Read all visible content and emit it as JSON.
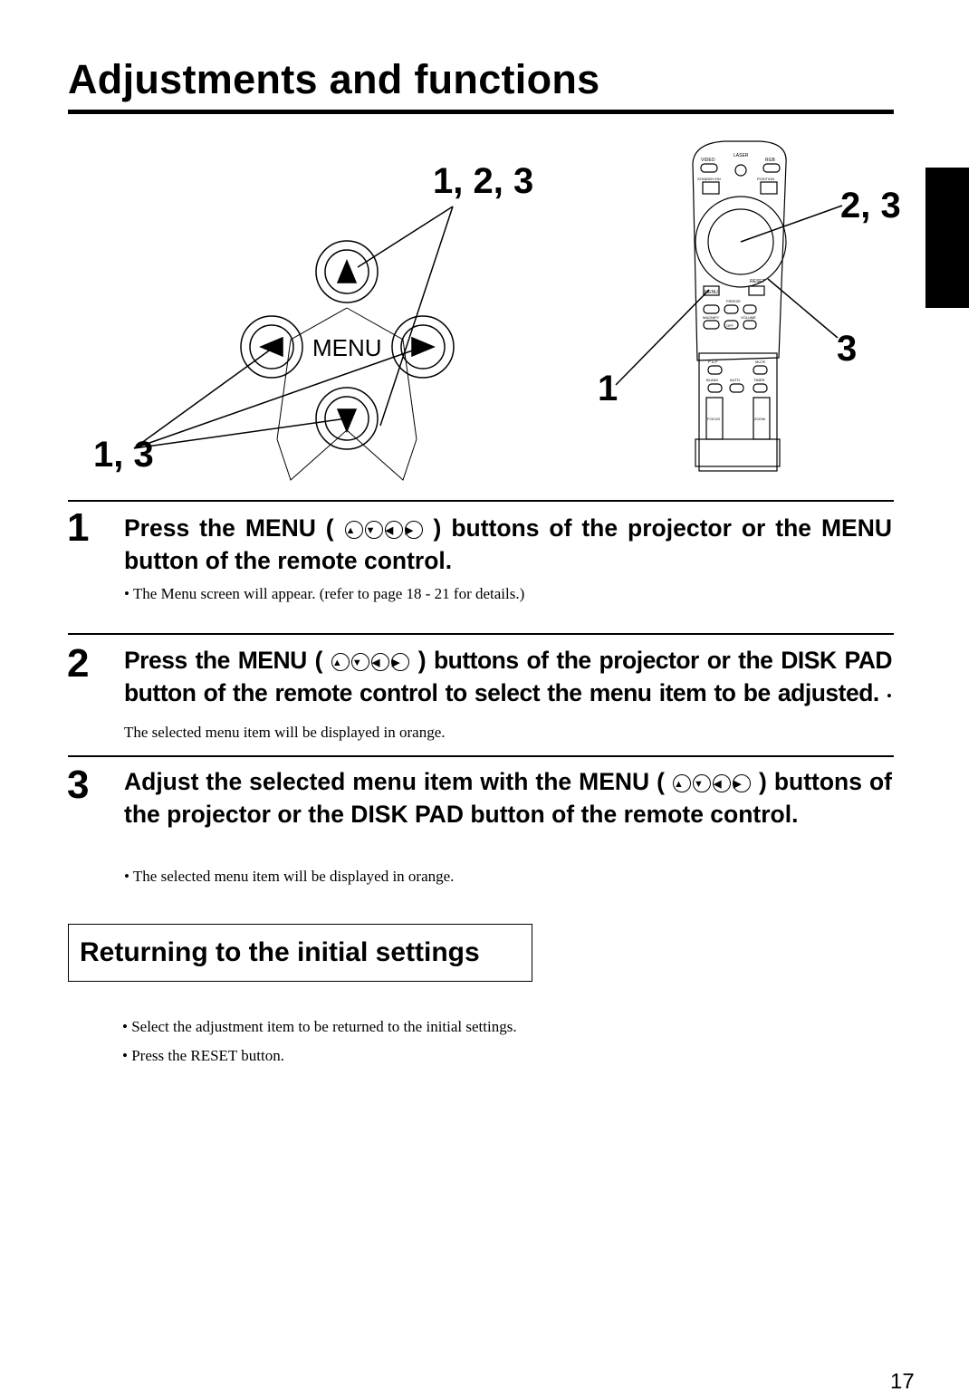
{
  "title": "Adjustments and functions",
  "illustration": {
    "panel_callout_top": "1, 2, 3",
    "panel_callout_bottom": "1, 3",
    "panel_menu_label": "MENU",
    "remote_callout_disk": "2, 3",
    "remote_callout_reset": "3",
    "remote_callout_menu": "1",
    "remote_labels": {
      "video": "VIDEO",
      "laser": "LASER",
      "rgb": "RGB",
      "standby": "STANDBY/ON",
      "position": "POSITION",
      "reset": "RESET",
      "menu": "MENU",
      "freeze": "FREEZE",
      "magnify": "MAGNIFY",
      "volume": "VOLUME",
      "off": "OFF",
      "pinp": "P in P",
      "mute": "MUTE",
      "blank": "BLANK",
      "auto": "AUTO",
      "timer": "TIMER",
      "focus": "FOCUS",
      "zoom": "ZOOM"
    }
  },
  "icons": {
    "up": "▲",
    "down": "▼",
    "left": "◀",
    "right": "▶"
  },
  "steps": [
    {
      "number": "1",
      "heading_a": "Press the MENU (",
      "heading_b": ") buttons of the projector or the MENU button of the remote control.",
      "note": "• The Menu screen will appear. (refer to page 18 - 21 for details.)"
    },
    {
      "number": "2",
      "heading_a": "Press the MENU (",
      "heading_b": ") buttons of the projector or the DISK PAD button of the remote control to select the menu item to be adjusted.",
      "note": "• The selected menu item will be displayed in orange."
    },
    {
      "number": "3",
      "heading_a": "Adjust the selected menu item with the MENU (",
      "heading_b": ") buttons of the projector or the DISK PAD button of the remote control.",
      "note": "• The selected menu item will be displayed in orange."
    }
  ],
  "reset_section": {
    "heading": "Returning to the initial settings",
    "bullets": [
      "• Select the adjustment item to be returned to the initial settings.",
      "• Press the RESET button."
    ]
  },
  "page_number": "17"
}
